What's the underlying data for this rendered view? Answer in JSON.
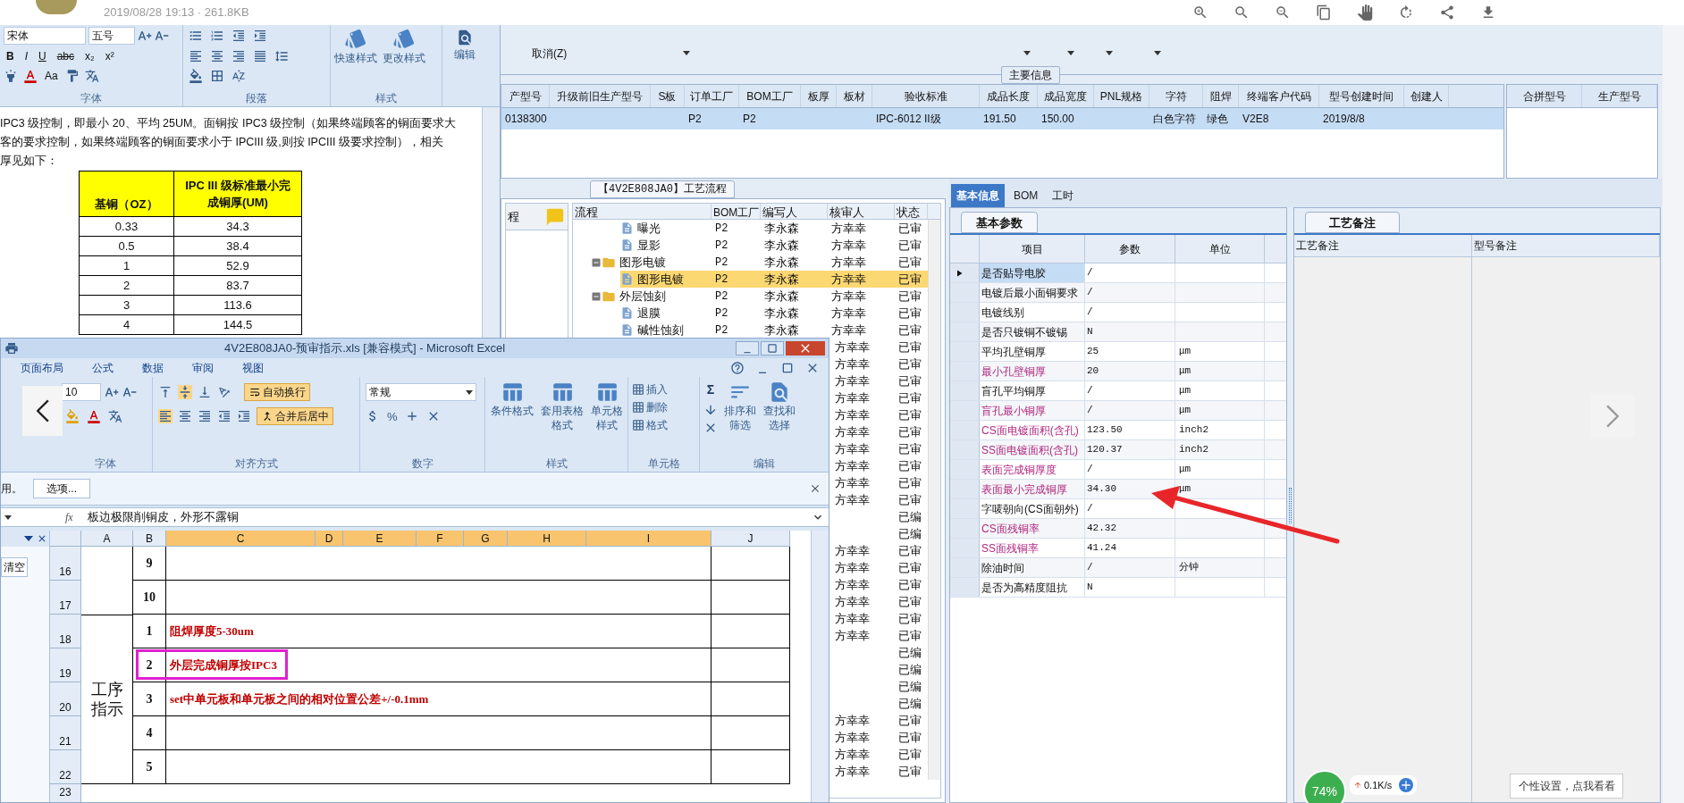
{
  "viewer": {
    "file_info": "2019/08/28 19:13 · 261.8KB"
  },
  "word": {
    "font_name": "宋体",
    "font_size": "五号",
    "format_buttons": [
      "B",
      "I",
      "U",
      "abc",
      "x₂",
      "x²"
    ],
    "case_button": "Aa",
    "groups": [
      "字体",
      "段落",
      "样式"
    ],
    "style_buttons": [
      "快速样式",
      "更改样式"
    ],
    "edit_button": "编辑",
    "paragraph_lines": [
      "IPC3 级控制，即最小 20、平均 25UM。面铜按 IPC3 级控制（如果终端顾客的铜面要求大",
      "客的要求控制，如果终端顾客的铜面要求小于 IPCIII 级,则按 IPCIII 级要求控制），相关",
      "厚见如下："
    ],
    "table": {
      "columns": [
        "基铜（OZ）",
        "IPC III 级标准最小完成铜厚(UM)"
      ],
      "rows": [
        [
          "0.33",
          "34.3"
        ],
        [
          "0.5",
          "38.4"
        ],
        [
          "1",
          "52.9"
        ],
        [
          "2",
          "83.7"
        ],
        [
          "3",
          "113.6"
        ],
        [
          "4",
          "144.5"
        ]
      ]
    }
  },
  "excel": {
    "title": "4V2E808JA0-预审指示.xls  [兼容模式] - Microsoft Excel",
    "tabs": [
      "页面布局",
      "公式",
      "数据",
      "审阅",
      "视图"
    ],
    "font_size": "10",
    "wrap_button": {
      "label": "自动换行",
      "on": true
    },
    "merge_button": {
      "label": "合并后居中",
      "on": true
    },
    "number_format": "常规",
    "number_symbols": [
      "%"
    ],
    "style_buttons": [
      "条件格式",
      "套用表格格式",
      "单元格样式"
    ],
    "cell_buttons": [
      "插入",
      "删除",
      "格式"
    ],
    "sum_symbol": "Σ",
    "edit_buttons": [
      "排序和筛选",
      "查找和选择"
    ],
    "function_label": "fx",
    "groups": [
      "字体",
      "对齐方式",
      "数字",
      "样式",
      "单元格",
      "编辑"
    ],
    "message": "用。",
    "options_button": "选项...",
    "formula": "板边极限削铜皮，外形不露铜",
    "task_pane_button": "清空",
    "columns": [
      {
        "label": "A",
        "selected": false
      },
      {
        "label": "B",
        "selected": false
      },
      {
        "label": "C",
        "selected": true
      },
      {
        "label": "D",
        "selected": true
      },
      {
        "label": "E",
        "selected": true
      },
      {
        "label": "F",
        "selected": true
      },
      {
        "label": "G",
        "selected": true
      },
      {
        "label": "H",
        "selected": true
      },
      {
        "label": "I",
        "selected": true
      },
      {
        "label": "J",
        "selected": false
      }
    ],
    "row_groups": [
      {
        "rows": [
          {
            "number": "16",
            "step": "9",
            "highlighted": false
          },
          {
            "number": "17",
            "step": "10",
            "highlighted": false
          }
        ]
      },
      {
        "label": "工序指示",
        "rows": [
          {
            "number": "18",
            "step": "1",
            "instruction": "阻焊厚度5-30um",
            "highlighted": false
          },
          {
            "number": "19",
            "step": "2",
            "instruction": "外层完成铜厚按IPC3",
            "highlighted": true
          },
          {
            "number": "20",
            "step": "3",
            "instruction": "set中单元板和单元板之间的相对位置公差+/-0.1mm",
            "highlighted": false
          },
          {
            "number": "21",
            "step": "4",
            "highlighted": false
          },
          {
            "number": "22",
            "step": "5",
            "highlighted": false
          }
        ]
      }
    ],
    "partial_row": "23"
  },
  "erp": {
    "menu_item": "取消(Z)",
    "main_info": {
      "title": "主要信息",
      "columns": [
        "产型号",
        "升级前旧生产型号",
        "S板",
        "订单工厂",
        "BOM工厂",
        "板厚",
        "板材",
        "验收标准",
        "成品长度",
        "成品宽度",
        "PNL规格",
        "字符",
        "阻焊",
        "终端客户代码",
        "型号创建时间",
        "创建人"
      ],
      "rows": [
        {
          "selected": true,
          "cells": [
            "0138300",
            null,
            null,
            "P2",
            "P2",
            null,
            null,
            "IPC-6012 II级",
            "191.50",
            "150.00",
            null,
            "白色字符",
            "绿色",
            "V2E8",
            "2019/8/8",
            null
          ]
        }
      ]
    },
    "merge_table": {
      "columns": [
        "合拼型号",
        "生产型号"
      ]
    },
    "process_flow": {
      "title": "【4V2E808JA0】工艺流程",
      "side_label": "程",
      "columns": [
        "流程",
        "BOM工厂",
        "编写人",
        "核审人",
        "状态"
      ],
      "tree": [
        {
          "children": [
            {
              "name": "曝光",
              "kind": "file",
              "selected": false,
              "factory": "P2",
              "writer": "李永森",
              "reviewer": "方幸幸",
              "status": "已审"
            },
            {
              "name": "显影",
              "kind": "file",
              "selected": false,
              "factory": "P2",
              "writer": "李永森",
              "reviewer": "方幸幸",
              "status": "已审"
            }
          ]
        },
        {
          "name": "图形电镀",
          "kind": "folder",
          "expanded": true,
          "selected": false,
          "factory": "P2",
          "writer": "李永森",
          "reviewer": "方幸幸",
          "status": "已审",
          "children": [
            {
              "name": "图形电镀",
              "kind": "file",
              "selected": true,
              "factory": "P2",
              "writer": "李永森",
              "reviewer": "方幸幸",
              "status": "已审"
            }
          ]
        },
        {
          "name": "外层蚀刻",
          "kind": "folder",
          "expanded": true,
          "selected": false,
          "factory": "P2",
          "writer": "李永森",
          "reviewer": "方幸幸",
          "status": "已审",
          "children": [
            {
              "name": "退膜",
              "kind": "file",
              "selected": false,
              "factory": "P2",
              "writer": "李永森",
              "reviewer": "方幸幸",
              "status": "已审"
            },
            {
              "name": "碱性蚀刻",
              "kind": "file",
              "selected": false,
              "factory": "P2",
              "writer": "李永森",
              "reviewer": "方幸幸",
              "status": "已审"
            }
          ]
        }
      ],
      "covered_rows": [
        {
          "reviewer": "方幸幸",
          "status": "已审"
        },
        {
          "reviewer": "方幸幸",
          "status": "已审"
        },
        {
          "reviewer": "方幸幸",
          "status": "已审"
        },
        {
          "reviewer": "方幸幸",
          "status": "已审"
        },
        {
          "reviewer": "方幸幸",
          "status": "已审"
        },
        {
          "reviewer": "方幸幸",
          "status": "已审"
        },
        {
          "reviewer": "方幸幸",
          "status": "已审"
        },
        {
          "reviewer": "方幸幸",
          "status": "已审"
        },
        {
          "reviewer": "方幸幸",
          "status": "已审"
        },
        {
          "reviewer": "方幸幸",
          "status": "已审"
        },
        {
          "status": "已编"
        },
        {
          "status": "已编"
        },
        {
          "reviewer": "方幸幸",
          "status": "已审"
        },
        {
          "reviewer": "方幸幸",
          "status": "已审"
        },
        {
          "reviewer": "方幸幸",
          "status": "已审"
        },
        {
          "reviewer": "方幸幸",
          "status": "已审"
        },
        {
          "reviewer": "方幸幸",
          "status": "已审"
        },
        {
          "reviewer": "方幸幸",
          "status": "已审"
        },
        {
          "status": "已编"
        },
        {
          "status": "已编"
        },
        {
          "status": "已编"
        },
        {
          "status": "已编"
        },
        {
          "reviewer": "方幸幸",
          "status": "已审"
        },
        {
          "reviewer": "方幸幸",
          "status": "已审"
        },
        {
          "reviewer": "方幸幸",
          "status": "已审"
        },
        {
          "reviewer": "方幸幸",
          "status": "已审"
        }
      ]
    },
    "detail_tabs": [
      {
        "label": "基本信息",
        "selected": true
      },
      {
        "label": "BOM",
        "selected": false
      },
      {
        "label": "工时",
        "selected": false
      }
    ],
    "params": {
      "tab": "基本参数",
      "columns": [
        "项目",
        "参数",
        "单位"
      ],
      "rows": [
        {
          "item": "是否贴导电胶",
          "value": "/",
          "emphasis": false,
          "selected": true
        },
        {
          "item": "电镀后最小面铜要求",
          "value": "/",
          "emphasis": false,
          "selected": false
        },
        {
          "item": "电镀线别",
          "value": "/",
          "emphasis": false,
          "selected": false
        },
        {
          "item": "是否只镀铜不镀锡",
          "value": "N",
          "emphasis": false,
          "selected": false
        },
        {
          "item": "平均孔壁铜厚",
          "value": "25",
          "unit": "μm",
          "emphasis": false,
          "selected": false
        },
        {
          "item": "最小孔壁铜厚",
          "value": "20",
          "unit": "μm",
          "emphasis": true,
          "selected": false
        },
        {
          "item": "盲孔平均铜厚",
          "value": "/",
          "unit": "μm",
          "emphasis": false,
          "selected": false
        },
        {
          "item": "盲孔最小铜厚",
          "value": "/",
          "unit": "μm",
          "emphasis": true,
          "selected": false
        },
        {
          "item": "CS面电镀面积(含孔)",
          "value": "123.50",
          "unit": "inch2",
          "emphasis": true,
          "selected": false
        },
        {
          "item": "SS面电镀面积(含孔)",
          "value": "120.37",
          "unit": "inch2",
          "emphasis": true,
          "selected": false
        },
        {
          "item": "表面完成铜厚度",
          "value": "/",
          "unit": "μm",
          "emphasis": true,
          "selected": false
        },
        {
          "item": "表面最小完成铜厚",
          "value": "34.30",
          "unit": "μm",
          "emphasis": true,
          "selected": false
        },
        {
          "item": "字唛朝向(CS面朝外)",
          "value": "/",
          "emphasis": false,
          "selected": false
        },
        {
          "item": "CS面残铜率",
          "value": "42.32",
          "emphasis": true,
          "selected": false
        },
        {
          "item": "SS面残铜率",
          "value": "41.24",
          "emphasis": true,
          "selected": false
        },
        {
          "item": "除油时间",
          "value": "/",
          "unit": "分钟",
          "emphasis": false,
          "selected": false
        },
        {
          "item": "是否为高精度阻抗",
          "value": "N",
          "emphasis": false,
          "selected": false
        }
      ]
    },
    "notes": {
      "tab": "工艺备注",
      "columns": [
        "工艺备注",
        "型号备注"
      ]
    }
  },
  "net_widget": {
    "percent": "74%",
    "speed": "0.1K/s"
  },
  "tooltip": "个性设置，点我看看"
}
